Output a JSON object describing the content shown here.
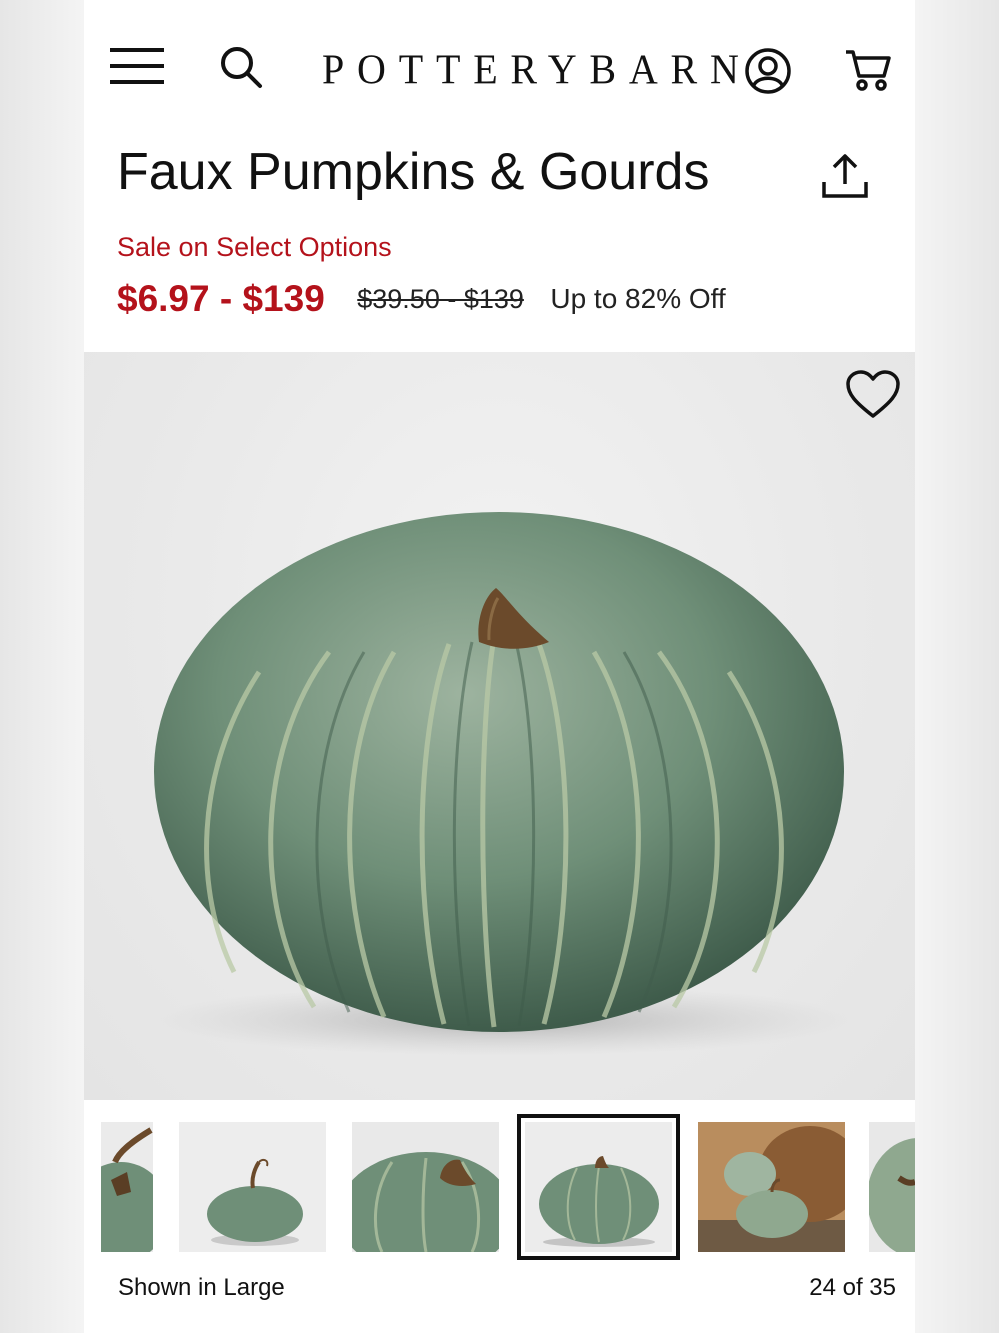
{
  "header": {
    "menu_icon": "hamburger-menu-icon",
    "search_icon": "search-icon",
    "logo_text": "PotteryBarn",
    "account_icon": "account-icon",
    "cart_icon": "cart-icon"
  },
  "product": {
    "title": "Faux Pumpkins & Gourds",
    "share_icon": "share-icon",
    "sale_label": "Sale on Select Options",
    "sale_price": "$6.97 - $139",
    "original_price": "$39.50 - $139",
    "discount": "Up to 82% Off"
  },
  "gallery": {
    "favorite_icon": "heart-icon",
    "shown_in": "Shown in Large",
    "counter": "24 of 35",
    "selected_index": 4,
    "thumbnail_count": 6
  },
  "colors": {
    "sale_red": "#b4121b",
    "pumpkin_green": "#6f8f78",
    "pumpkin_dark": "#4f6d5b",
    "stem_brown": "#6b4a2b"
  }
}
